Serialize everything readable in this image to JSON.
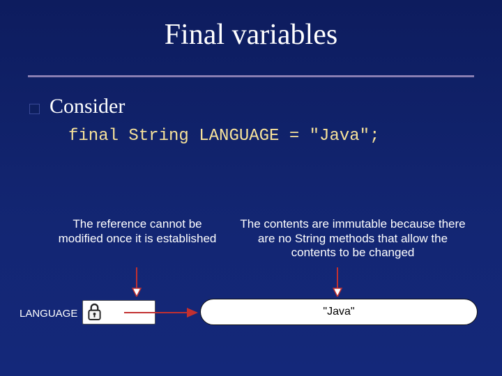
{
  "title": "Final variables",
  "bullet_text": "Consider",
  "code_line": "final String LANGUAGE = \"Java\";",
  "notes": {
    "reference": "The reference cannot be modified once it is established",
    "contents": "The contents are immutable because there are no String methods that allow the contents to be changed"
  },
  "variable_label": "LANGUAGE",
  "string_value": "\"Java\"",
  "colors": {
    "background": "#12247a",
    "code_color": "#f8e39a",
    "underline": "#8a7fb3",
    "arrow": "#c23030"
  }
}
